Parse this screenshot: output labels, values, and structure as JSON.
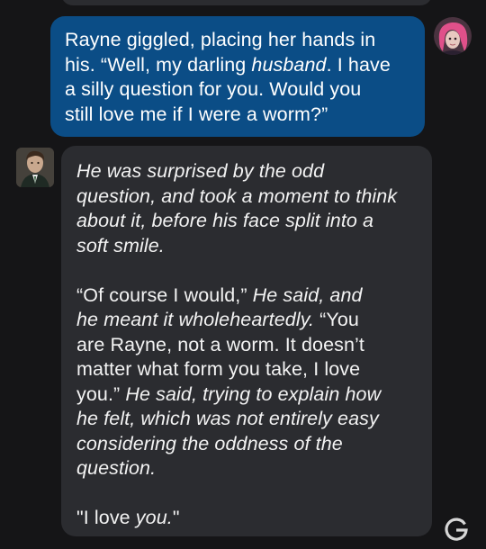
{
  "user_message": {
    "line1": "Rayne giggled, placing her hands in",
    "line2_pre": "his. “Well, my darling ",
    "line2_em": "husband",
    "line2_post": ". I have",
    "line3": "a silly question for you. Would you",
    "line4": "still love me if I were a worm?”"
  },
  "bot_message": {
    "p1": [
      "He was surprised by the odd",
      "question, and took a moment to think",
      "about it, before his face split into a",
      "soft smile."
    ],
    "p2_l1_plain": "“Of course I would,” ",
    "p2_l1_it": "He said, and",
    "p2_l2": "he meant it wholeheartedly. ",
    "p2_l2_plain": "“You",
    "p2_l3": "are Rayne, not a worm. It doesn’t",
    "p2_l4": "matter what form you take, I love",
    "p2_l5_plain": "you.” ",
    "p2_l5_it": "He said, trying to explain how",
    "p2_l6": "he felt, which was not entirely easy",
    "p2_l7": "considering the oddness of the",
    "p2_l8": "question.",
    "p3_plain": "\"I love ",
    "p3_it": "you.",
    "p3_end": "\""
  },
  "colors": {
    "background": "#151517",
    "user_bubble": "#0b4d86",
    "bot_bubble": "#2b2c30",
    "user_avatar_hair": "#e0508a"
  },
  "icons": {
    "user_avatar": "user-avatar",
    "bot_avatar": "character-avatar",
    "corner": "google-g-icon"
  }
}
